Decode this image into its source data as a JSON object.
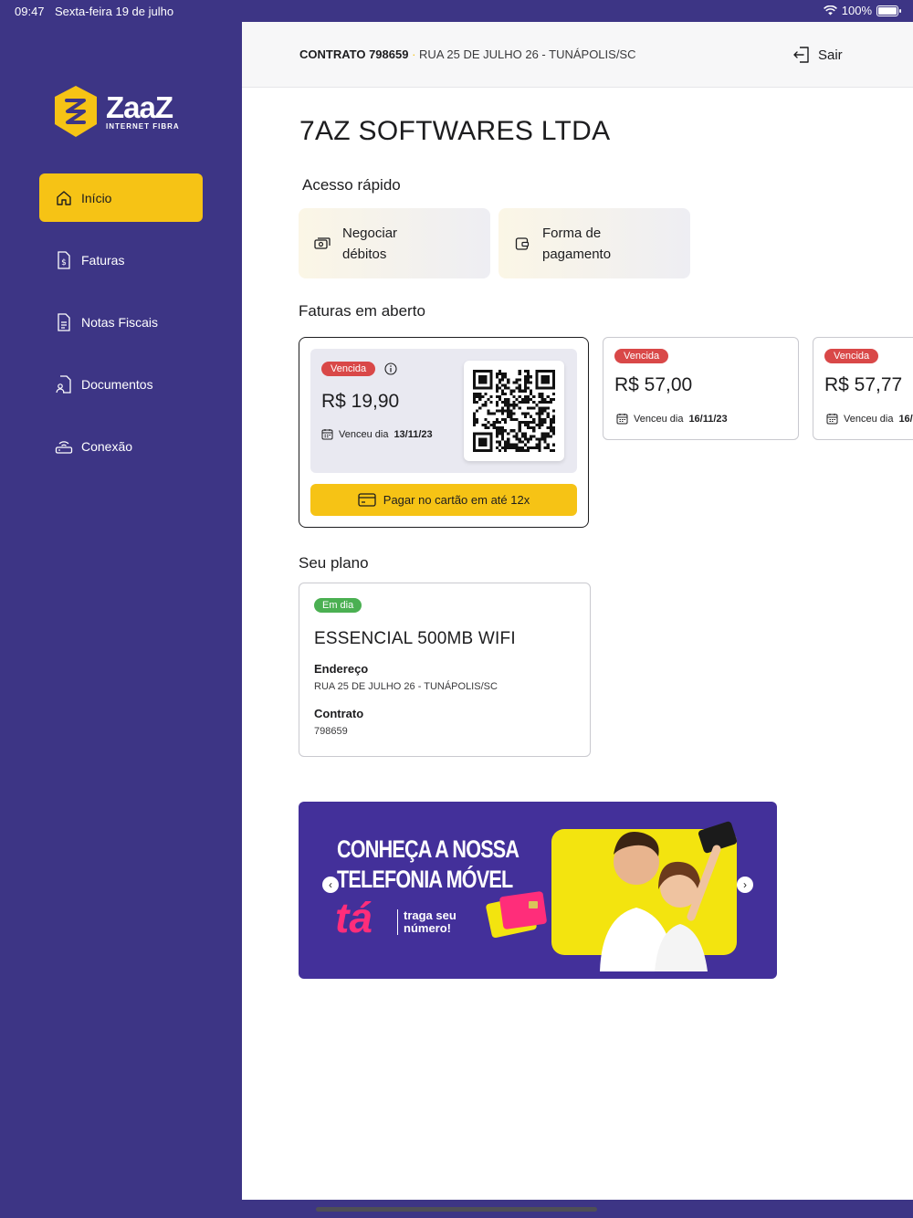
{
  "status_bar": {
    "time": "09:47",
    "date": "Sexta-feira 19 de julho",
    "battery": "100%"
  },
  "brand": {
    "name": "ZaaZ",
    "tagline": "INTERNET FIBRA",
    "accent": "#f6c315",
    "sidebar_bg": "#3d3585"
  },
  "nav": {
    "items": [
      {
        "label": "Início",
        "icon": "home-icon",
        "active": true
      },
      {
        "label": "Faturas",
        "icon": "invoice-icon"
      },
      {
        "label": "Notas Fiscais",
        "icon": "document-icon"
      },
      {
        "label": "Documentos",
        "icon": "user-document-icon"
      },
      {
        "label": "Conexão",
        "icon": "router-icon"
      }
    ]
  },
  "header": {
    "contract_label": "CONTRATO 798659",
    "separator": "·",
    "address": "RUA 25 DE JULHO 26 - TUNÁPOLIS/SC",
    "logout": "Sair"
  },
  "company": "7AZ SOFTWARES LTDA",
  "quick_access": {
    "title": "Acesso rápido",
    "items": [
      {
        "label": "Negociar débitos",
        "icon": "money-icon"
      },
      {
        "label": "Forma de pagamento",
        "icon": "wallet-icon"
      }
    ]
  },
  "open_invoices": {
    "title": "Faturas em aberto",
    "items": [
      {
        "status": "Vencida",
        "amount": "R$ 19,90",
        "due_prefix": "Venceu dia",
        "due_date": "13/11/23",
        "pay_button": "Pagar no cartão em até 12x"
      },
      {
        "status": "Vencida",
        "amount": "R$ 57,00",
        "due_prefix": "Venceu dia",
        "due_date": "16/11/23"
      },
      {
        "status": "Vencida",
        "amount": "R$ 57,77",
        "due_prefix": "Venceu dia",
        "due_date": "16/"
      }
    ]
  },
  "plan": {
    "title": "Seu plano",
    "status": "Em dia",
    "name": "ESSENCIAL 500MB WIFI",
    "address_label": "Endereço",
    "address": "RUA 25 DE JULHO 26 - TUNÁPOLIS/SC",
    "contract_label": "Contrato",
    "contract": "798659"
  },
  "banner": {
    "headline_1": "CONHEÇA A NOSSA",
    "headline_2": "TELEFONIA MÓVEL",
    "brand": "tá",
    "sub_1": "traga seu",
    "sub_2": "número!",
    "prev": "‹",
    "next": "›"
  }
}
